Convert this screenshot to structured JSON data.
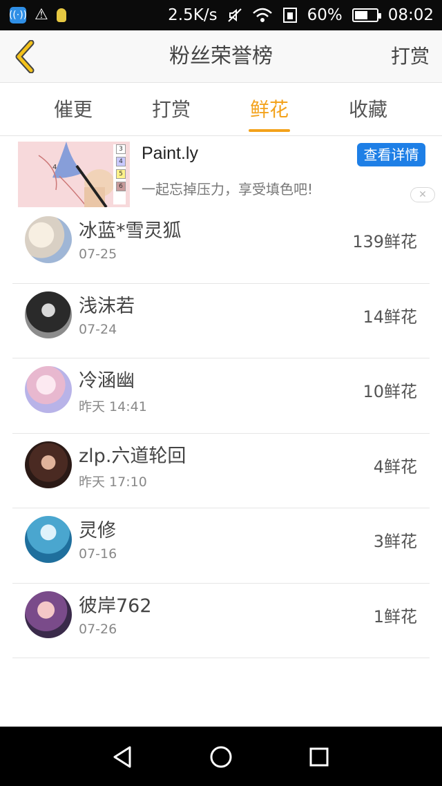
{
  "status_bar": {
    "speed": "2.5K/s",
    "battery_percent": "60%",
    "battery_level": 0.6,
    "time": "08:02"
  },
  "header": {
    "title": "粉丝荣誉榜",
    "action_label": "打赏"
  },
  "tabs": [
    {
      "label": "催更",
      "active": false
    },
    {
      "label": "打赏",
      "active": false
    },
    {
      "label": "鲜花",
      "active": true
    },
    {
      "label": "收藏",
      "active": false
    }
  ],
  "ad": {
    "title": "Paint.ly",
    "description": "一起忘掉压力，享受填色吧!",
    "button_label": "查看详情",
    "close_glyph": "✕",
    "palette_numbers": [
      "3",
      "4",
      "5",
      "6"
    ],
    "image_number": "4"
  },
  "list": [
    {
      "name": "冰蓝*雪灵狐",
      "date": "07-25",
      "count": "139鲜花"
    },
    {
      "name": "浅沫若",
      "date": "07-24",
      "count": "14鲜花"
    },
    {
      "name": "冷涵幽",
      "date": "昨天 14:41",
      "count": "10鲜花"
    },
    {
      "name": "zlp.六道轮回",
      "date": "昨天 17:10",
      "count": "4鲜花"
    },
    {
      "name": "灵修",
      "date": "07-16",
      "count": "3鲜花"
    },
    {
      "name": "彼岸762",
      "date": "07-26",
      "count": "1鲜花"
    }
  ],
  "colors": {
    "accent": "#f3a21b",
    "ad_button": "#1e7fe6",
    "status_bar": "#0b0b0b",
    "nav_bar": "#000000"
  },
  "icons": {
    "back": "chevron-left-icon",
    "nav": [
      "back-triangle-icon",
      "home-circle-icon",
      "recents-square-icon"
    ]
  }
}
